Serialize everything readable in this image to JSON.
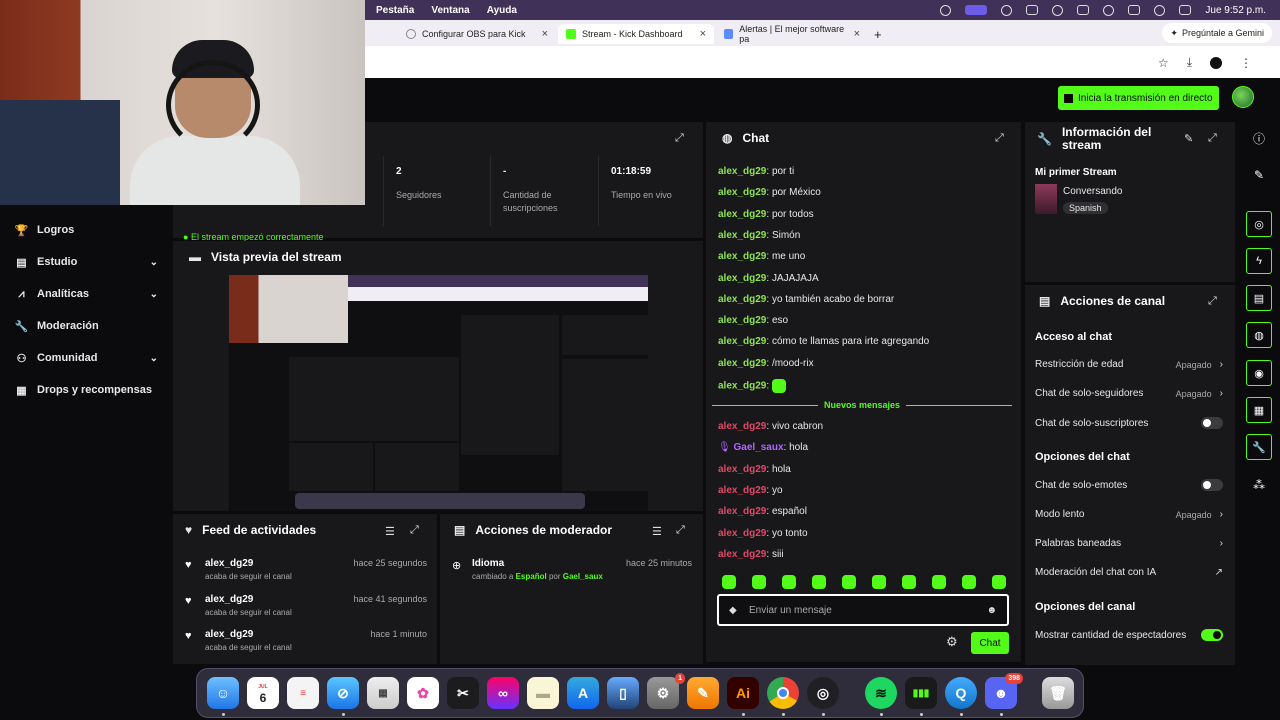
{
  "menubar": {
    "items": [
      "Pestaña",
      "Ventana",
      "Ayuda"
    ],
    "clock": "Jue 9:52 p.m."
  },
  "tabs": [
    {
      "label": "Configurar OBS para Kick",
      "icon": "globe-icon"
    },
    {
      "label": "Stream - Kick Dashboard",
      "icon": "kick-icon"
    },
    {
      "label": "Alertas | El mejor software pa",
      "icon": "alert-app-icon"
    }
  ],
  "gemini": {
    "label": "Pregúntale a Gemini"
  },
  "header": {
    "go_live_label": "Inicia la transmisión en directo"
  },
  "nav": {
    "items": [
      {
        "label": "Logros",
        "icon": "trophy-icon",
        "has_chevron": false
      },
      {
        "label": "Estudio",
        "icon": "studio-icon",
        "has_chevron": true
      },
      {
        "label": "Analíticas",
        "icon": "analytics-icon",
        "has_chevron": true
      },
      {
        "label": "Moderación",
        "icon": "wrench-icon",
        "has_chevron": false
      },
      {
        "label": "Comunidad",
        "icon": "community-icon",
        "has_chevron": true
      },
      {
        "label": "Drops y recompensas",
        "icon": "drops-icon",
        "has_chevron": false
      }
    ]
  },
  "stats": {
    "cells": [
      {
        "value": "2",
        "label": "Seguidores"
      },
      {
        "value": "-",
        "label": "Cantidad de suscripciones"
      },
      {
        "value": "01:18:59",
        "label": "Tiempo en vivo"
      }
    ],
    "notice": "El stream empezó correctamente"
  },
  "preview": {
    "title": "Vista previa del stream"
  },
  "feed": {
    "title": "Feed de actividades",
    "items": [
      {
        "user": "alex_dg29",
        "time": "hace 25 segundos",
        "desc": "acaba de seguir el canal"
      },
      {
        "user": "alex_dg29",
        "time": "hace 41 segundos",
        "desc": "acaba de seguir el canal"
      },
      {
        "user": "alex_dg29",
        "time": "hace 1 minuto",
        "desc": "acaba de seguir el canal"
      }
    ]
  },
  "mod_actions": {
    "title": "Acciones de moderador",
    "items": [
      {
        "title": "Idioma",
        "time": "hace 25 minutos",
        "desc_pre": "cambiado a",
        "value": "Español",
        "by": "por",
        "user": "Gael_saux"
      }
    ]
  },
  "chat": {
    "title": "Chat",
    "messages_before": [
      {
        "user": "alex_dg29",
        "text": "por ti"
      },
      {
        "user": "alex_dg29",
        "text": "por México"
      },
      {
        "user": "alex_dg29",
        "text": "por todos"
      },
      {
        "user": "alex_dg29",
        "text": "Simón"
      },
      {
        "user": "alex_dg29",
        "text": "me uno"
      },
      {
        "user": "alex_dg29",
        "text": "JAJAJAJA"
      },
      {
        "user": "alex_dg29",
        "text": "yo también acabo de borrar"
      },
      {
        "user": "alex_dg29",
        "text": "eso"
      },
      {
        "user": "alex_dg29",
        "text": "cómo te llamas para irte agregando"
      },
      {
        "user": "alex_dg29",
        "text": "/mood-rix"
      },
      {
        "user": "alex_dg29",
        "text": ""
      }
    ],
    "new_messages_label": "Nuevos mensajes",
    "messages_after": [
      {
        "user": "alex_dg29",
        "text": "vivo cabron",
        "color": "red"
      },
      {
        "user": "Gael_saux",
        "text": "hola",
        "color": "purple"
      },
      {
        "user": "alex_dg29",
        "text": "hola",
        "color": "red"
      },
      {
        "user": "alex_dg29",
        "text": "yo",
        "color": "red"
      },
      {
        "user": "alex_dg29",
        "text": "español",
        "color": "red"
      },
      {
        "user": "alex_dg29",
        "text": "yo tonto",
        "color": "red"
      },
      {
        "user": "alex_dg29",
        "text": "siii",
        "color": "red"
      }
    ],
    "input_placeholder": "Enviar un mensaje",
    "send_label": "Chat"
  },
  "stream_info": {
    "title": "Información del stream",
    "stream_title": "Mi primer Stream",
    "category": "Conversando",
    "language_tag": "Spanish"
  },
  "channel_actions": {
    "title": "Acciones de canal",
    "sections": [
      {
        "title": "Acceso al chat",
        "rows": [
          {
            "label": "Restricción de edad",
            "status": "Apagado",
            "kind": "chevron"
          },
          {
            "label": "Chat de solo-seguidores",
            "status": "Apagado",
            "kind": "chevron"
          },
          {
            "label": "Chat de solo-suscriptores",
            "status": "",
            "kind": "toggle",
            "on": false
          }
        ]
      },
      {
        "title": "Opciones del chat",
        "rows": [
          {
            "label": "Chat de solo-emotes",
            "status": "",
            "kind": "toggle",
            "on": false
          },
          {
            "label": "Modo lento",
            "status": "Apagado",
            "kind": "chevron"
          },
          {
            "label": "Palabras baneadas",
            "status": "",
            "kind": "chevron"
          },
          {
            "label": "Moderación del chat con IA",
            "status": "",
            "kind": "external"
          }
        ]
      },
      {
        "title": "Opciones del canal",
        "rows": [
          {
            "label": "Mostrar cantidad de espectadores",
            "status": "",
            "kind": "toggle",
            "on": true
          }
        ]
      }
    ]
  },
  "dock": {
    "calendar_month": "JUL",
    "calendar_day": "6",
    "settings_badge": "1",
    "discord_badge": "398",
    "illustrator_label": "Ai"
  },
  "colors": {
    "accent": "#53fc18",
    "panel": "#18181b",
    "background": "#0b0b0e",
    "menubar": "#3f3158"
  }
}
